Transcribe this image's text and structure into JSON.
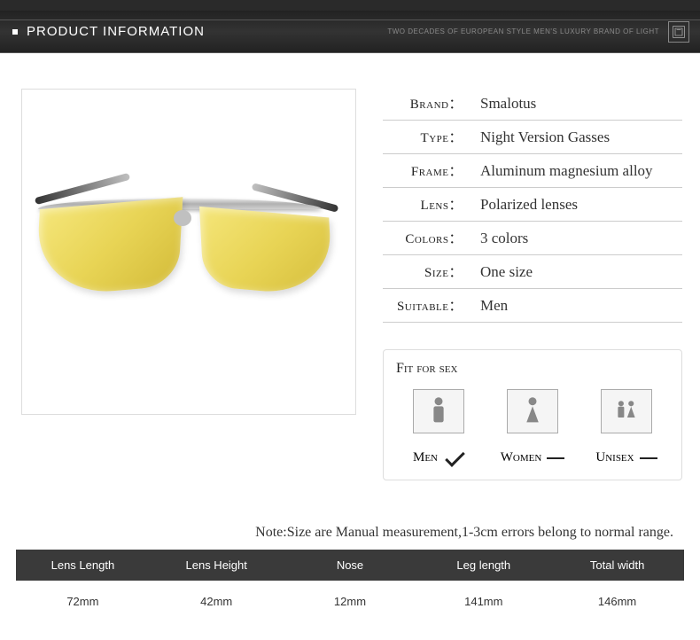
{
  "header": {
    "title": "PRODUCT INFORMATION",
    "tagline": "TWO DECADES OF EUROPEAN STYLE MEN'S LUXURY BRAND OF LIGHT"
  },
  "specs": [
    {
      "label": "Brand",
      "value": "Smalotus"
    },
    {
      "label": "Type",
      "value": "Night Version Gasses"
    },
    {
      "label": "Frame",
      "value": "Aluminum magnesium alloy"
    },
    {
      "label": "Lens",
      "value": "Polarized lenses"
    },
    {
      "label": "Colors",
      "value": "3 colors"
    },
    {
      "label": "Size",
      "value": "One size"
    },
    {
      "label": "Suitable",
      "value": "Men"
    }
  ],
  "fit": {
    "title": "Fit for sex",
    "items": [
      {
        "label": "Men",
        "checked": true
      },
      {
        "label": "Women",
        "checked": false
      },
      {
        "label": "Unisex",
        "checked": false
      }
    ]
  },
  "note": "Note:Size are Manual measurement,1-3cm errors belong to normal range.",
  "sizeTable": {
    "headers": [
      "Lens Length",
      "Lens Height",
      "Nose",
      "Leg length",
      "Total width"
    ],
    "values": [
      "72mm",
      "42mm",
      "12mm",
      "141mm",
      "146mm"
    ]
  }
}
